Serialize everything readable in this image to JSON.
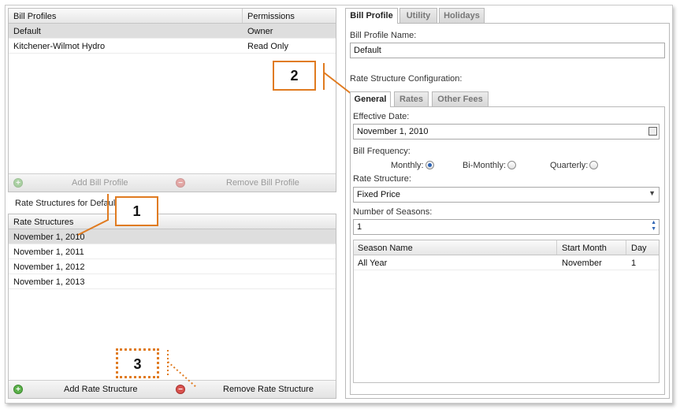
{
  "bill_profiles": {
    "columns": [
      "Bill Profiles",
      "Permissions"
    ],
    "rows": [
      {
        "name": "Default",
        "permission": "Owner"
      },
      {
        "name": "Kitchener-Wilmot Hydro",
        "permission": "Read Only"
      }
    ],
    "add_label": "Add Bill Profile",
    "remove_label": "Remove Bill Profile"
  },
  "rate_structures": {
    "section_title": "Rate Structures for Default",
    "column": "Rate Structures",
    "rows": [
      "November 1, 2010",
      "November 1, 2011",
      "November 1, 2012",
      "November 1, 2013"
    ],
    "add_label": "Add Rate Structure",
    "remove_label": "Remove Rate Structure"
  },
  "tabs": [
    "Bill Profile",
    "Utility",
    "Holidays"
  ],
  "profile": {
    "name_label": "Bill Profile Name:",
    "name_value": "Default",
    "rate_config_label": "Rate Structure Configuration:"
  },
  "subtabs": [
    "General",
    "Rates",
    "Other Fees"
  ],
  "general": {
    "effective_label": "Effective Date:",
    "effective_value": "November 1, 2010",
    "frequency_label": "Bill Frequency:",
    "freq_monthly": "Monthly:",
    "freq_bimonthly": "Bi-Monthly:",
    "freq_quarterly": "Quarterly:",
    "structure_label": "Rate Structure:",
    "structure_value": "Fixed Price",
    "seasons_label": "Number of Seasons:",
    "seasons_value": "1",
    "season_columns": [
      "Season Name",
      "Start Month",
      "Day"
    ],
    "season_rows": [
      {
        "name": "All Year",
        "month": "November",
        "day": "1"
      }
    ]
  },
  "callouts": [
    "1",
    "2",
    "3"
  ],
  "colors": {
    "callout": "#e07b20"
  }
}
